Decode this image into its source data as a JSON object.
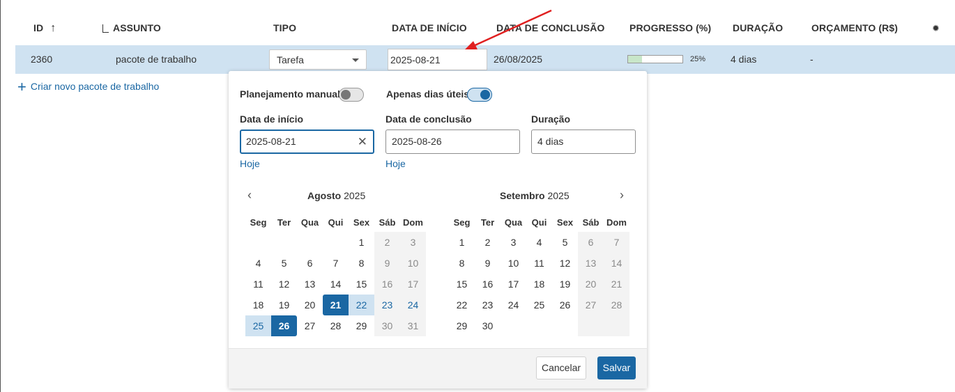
{
  "table": {
    "headers": {
      "id": "ID",
      "sort_icon": "↑",
      "assunto": "ASSUNTO",
      "tipo": "TIPO",
      "data_inicio": "DATA DE INÍCIO",
      "data_conclusao": "DATA DE CONCLUSÃO",
      "progresso": "PROGRESSO (%)",
      "duracao": "DURAÇÃO",
      "orcamento": "ORÇAMENTO (R$)"
    },
    "row": {
      "id": "2360",
      "assunto": "pacote de trabalho",
      "tipo": "Tarefa",
      "data_inicio": "2025-08-21",
      "data_conclusao": "26/08/2025",
      "progresso": 25,
      "progresso_label": "25%",
      "duracao": "4 dias",
      "orcamento": "-"
    },
    "create_link": "Criar novo pacote de trabalho"
  },
  "popover": {
    "manual_label": "Planejamento manual",
    "manual_on": false,
    "workdays_label": "Apenas dias úteis",
    "workdays_on": true,
    "start_label": "Data de início",
    "start_value": "2025-08-21",
    "end_label": "Data de conclusão",
    "end_value": "2025-08-26",
    "duration_label": "Duração",
    "duration_value": "4 dias",
    "today_label": "Hoje",
    "weekdays": [
      "Seg",
      "Ter",
      "Qua",
      "Qui",
      "Sex",
      "Sáb",
      "Dom"
    ],
    "months": [
      {
        "name": "Agosto",
        "year": "2025",
        "first_col": 4,
        "days": 31,
        "sel_start": 21,
        "sel_end": 26
      },
      {
        "name": "Setembro",
        "year": "2025",
        "first_col": 0,
        "days": 30,
        "sel_start": null,
        "sel_end": null
      }
    ],
    "cancel_label": "Cancelar",
    "save_label": "Salvar"
  },
  "colors": {
    "accent": "#1a67a3",
    "row_highlight": "#cfe2f1",
    "progress_fill": "#c8e6c9",
    "annotation_arrow": "#e02020"
  },
  "icons": {
    "settings": "gear-icon",
    "add": "plus-icon",
    "clear": "close-icon",
    "prev": "chevron-left-icon",
    "next": "chevron-right-icon",
    "sort": "arrow-up-icon",
    "hierarchy": "hierarchy-icon"
  }
}
